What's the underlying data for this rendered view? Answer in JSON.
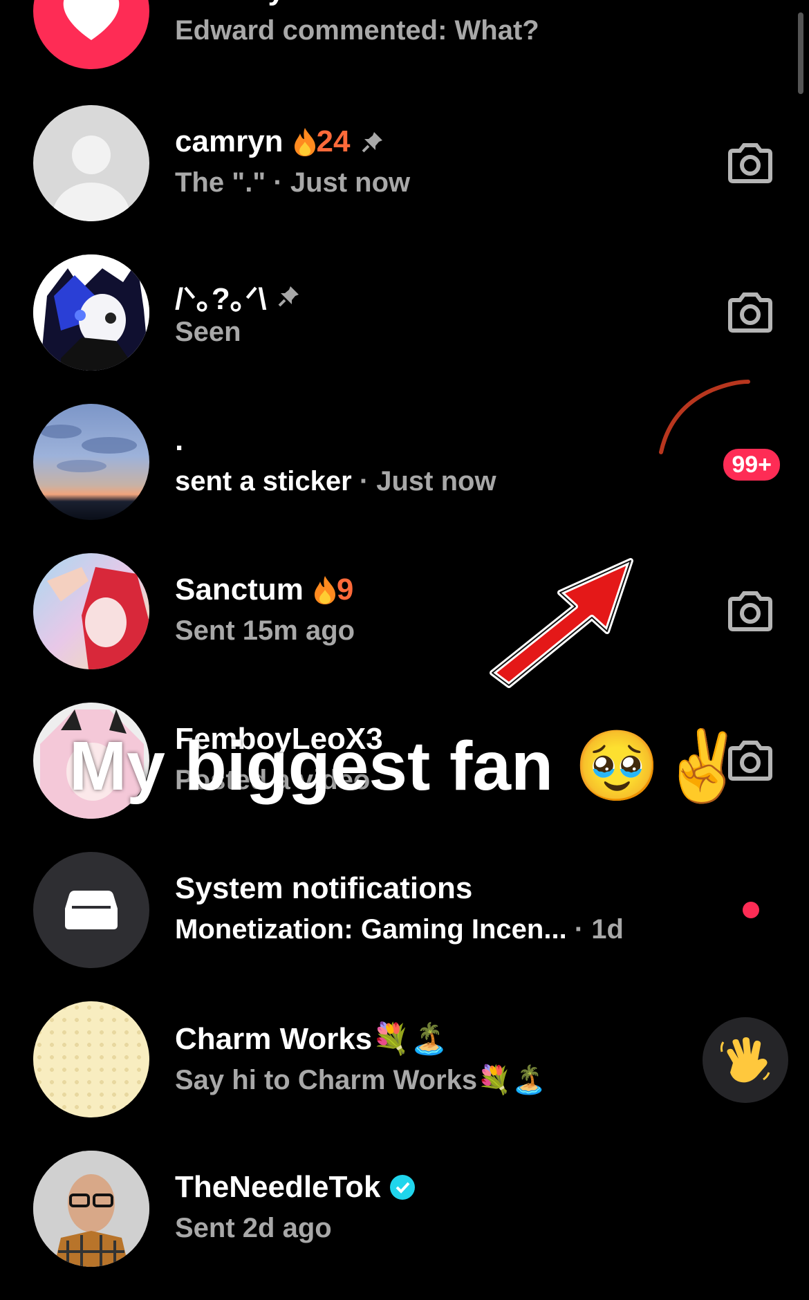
{
  "rows": [
    {
      "name": "Activity",
      "subtitle": "Edward commented: What?"
    },
    {
      "name": "camryn",
      "streak": "24",
      "subtitle": "The \".\" · Just now"
    },
    {
      "name": "/ᐠ｡?｡ᐟ\\",
      "subtitle": "Seen"
    },
    {
      "name": ".",
      "subtitle_bold": "sent a sticker",
      "subtitle_time": " · Just now",
      "badge": "99+"
    },
    {
      "name": "Sanctum",
      "streak": "9",
      "subtitle": "Sent 15m ago"
    },
    {
      "name": "FemboyLeoX3",
      "subtitle": "Posted a video"
    },
    {
      "name": "System notifications",
      "subtitle_bold": "Monetization: Gaming Incen...",
      "subtitle_time": " · 1d"
    },
    {
      "name": "Charm Works💐🏝️",
      "subtitle": "Say hi to Charm Works💐🏝️"
    },
    {
      "name": "TheNeedleTok",
      "subtitle": "Sent 2d ago"
    }
  ],
  "overlay": {
    "text": "My biggest fan",
    "emoji": "🥹✌️"
  },
  "colors": {
    "accent": "#fe2c55",
    "streak": "#ff6a3a",
    "verified": "#20d5ec"
  },
  "icons": [
    "heart-icon",
    "camera-icon",
    "pin-icon",
    "fire-icon",
    "inbox-icon",
    "wave-icon",
    "verified-icon",
    "arrow-icon"
  ]
}
